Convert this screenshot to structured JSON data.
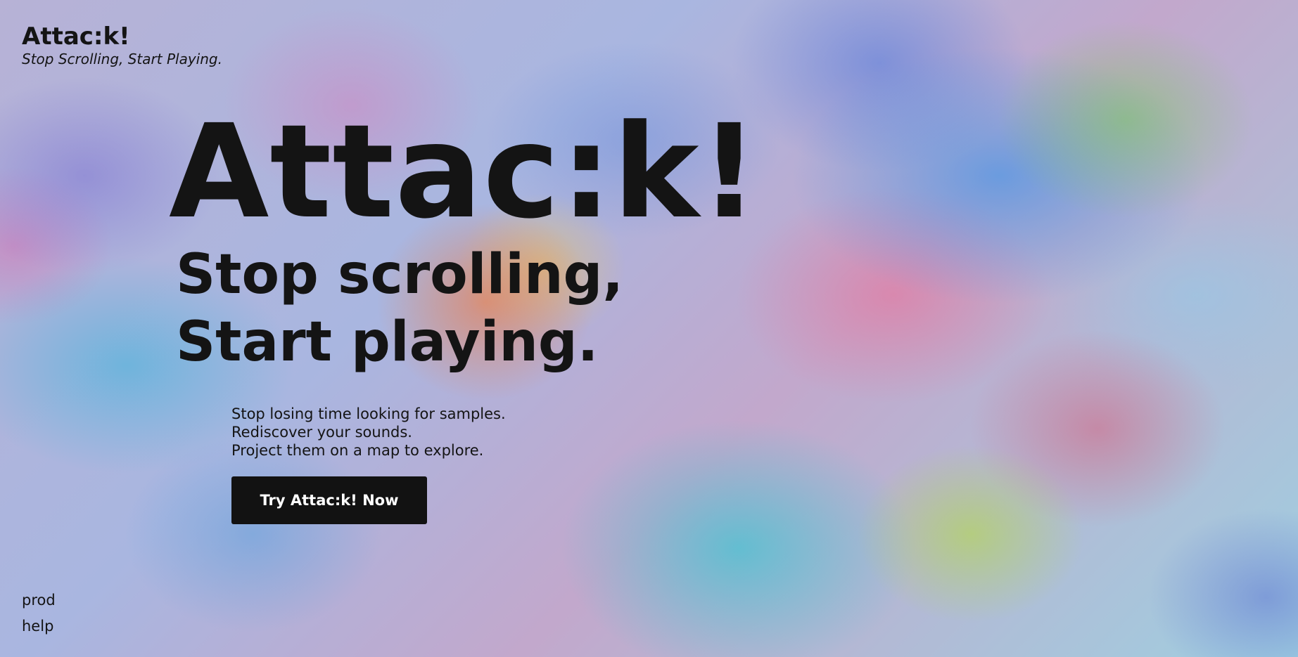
{
  "header": {
    "brand_title": "Attac:k!",
    "brand_tagline": "Stop Scrolling, Start Playing."
  },
  "hero": {
    "title": "Attac:k!",
    "slogan_line1": "Stop scrolling,",
    "slogan_line2": "Start playing.",
    "description": [
      "Stop losing time looking for samples.",
      "Rediscover your sounds.",
      "Project them on a map to explore."
    ],
    "cta_label": "Try Attac:k! Now"
  },
  "footer_nav": {
    "items": [
      "prod",
      "help"
    ]
  },
  "colors": {
    "text": "#141414",
    "button_bg": "#121212",
    "button_text": "#ffffff"
  }
}
